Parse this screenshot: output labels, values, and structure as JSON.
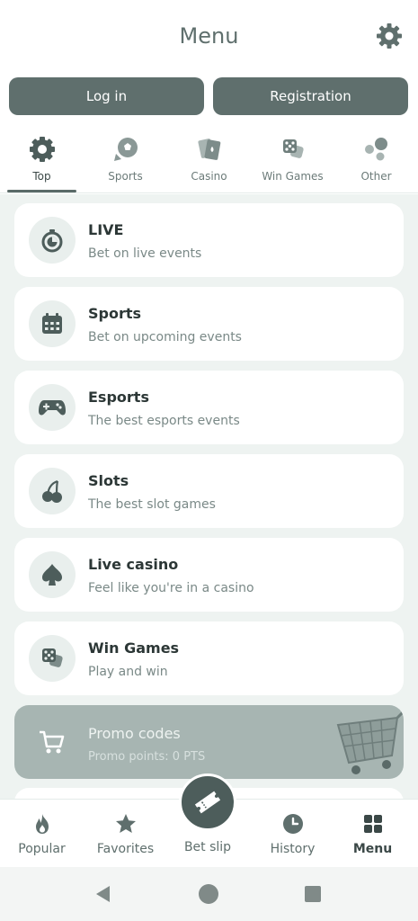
{
  "header": {
    "title": "Menu",
    "settings_icon": "gear-icon",
    "login_label": "Log in",
    "registration_label": "Registration"
  },
  "tabs": [
    {
      "label": "Top",
      "icon": "badge-icon",
      "active": true
    },
    {
      "label": "Sports",
      "icon": "soccer-ball-icon",
      "active": false
    },
    {
      "label": "Casino",
      "icon": "cards-icon",
      "active": false
    },
    {
      "label": "Win Games",
      "icon": "dice-icon",
      "active": false
    },
    {
      "label": "Other",
      "icon": "bubbles-icon",
      "active": false
    }
  ],
  "menu": [
    {
      "title": "LIVE",
      "subtitle": "Bet on live events",
      "icon": "stopwatch-icon"
    },
    {
      "title": "Sports",
      "subtitle": "Bet on upcoming events",
      "icon": "calendar-icon"
    },
    {
      "title": "Esports",
      "subtitle": "The best esports events",
      "icon": "gamepad-icon"
    },
    {
      "title": "Slots",
      "subtitle": "The best slot games",
      "icon": "cherries-icon"
    },
    {
      "title": "Live casino",
      "subtitle": "Feel like you're in a casino",
      "icon": "spade-icon"
    },
    {
      "title": "Win Games",
      "subtitle": "Play and win",
      "icon": "dice-icon"
    }
  ],
  "promo": {
    "title": "Promo codes",
    "subtitle": "Promo points: 0 PTS",
    "icon": "cart-icon"
  },
  "bottom_nav": [
    {
      "label": "Popular",
      "icon": "flame-icon",
      "active": false
    },
    {
      "label": "Favorites",
      "icon": "star-icon",
      "active": false
    },
    {
      "label": "Bet slip",
      "icon": "ticket-icon",
      "active": false
    },
    {
      "label": "History",
      "icon": "clock-icon",
      "active": false
    },
    {
      "label": "Menu",
      "icon": "grid-icon",
      "active": true
    }
  ],
  "colors": {
    "primary": "#5f6f6d",
    "background": "#eef3f1",
    "card": "#ffffff",
    "promo": "#a7b5b2"
  }
}
